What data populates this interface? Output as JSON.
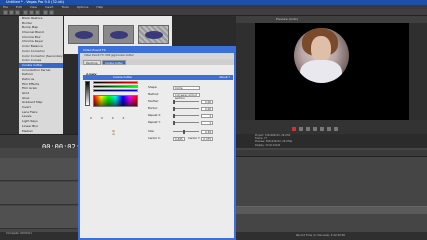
{
  "app": {
    "title": "Untitled * - Vegas Pro 9.0 (32-bit)"
  },
  "menu": [
    "File",
    "Edit",
    "View",
    "Insert",
    "Tools",
    "Options",
    "Help"
  ],
  "left_list": {
    "items": [
      "Black Restore",
      "Border",
      "Bump Map",
      "Channel Blend",
      "Chroma Blur",
      "Chroma Keyer",
      "Color Balance",
      "Color Corrector",
      "Color Corrector (Secondary)",
      "Color Curves",
      "Cookie Cutter",
      "Convolution Kernel",
      "Deform",
      "Defocus",
      "Film Effects",
      "Film Grain",
      "Glint",
      "Glow",
      "Gradient Map",
      "Invert",
      "Lens Flare",
      "Levels",
      "Light Rays",
      "Linear Blur",
      "Median",
      "Mirror",
      "Newsprint"
    ],
    "selected_index": 10,
    "footer_tabs": [
      "Project Media",
      "Explorer",
      "Transitions",
      "Video FX"
    ]
  },
  "timeline": {
    "timecode": "00:00:02;17"
  },
  "dialog": {
    "title": "Video Event FX",
    "subtitle": "Video Event FX: 003.jpg/Cookie Cutter",
    "tabs": [
      "Pan/Crop",
      "Cookie Cutter"
    ],
    "brand": "SONY",
    "plugin_name": "Cookie Cutter",
    "about_label": "About ?",
    "rgb_values": [
      "0",
      "0",
      "0",
      "0"
    ],
    "properties": {
      "shape": {
        "label": "Shape:",
        "value": "Circle"
      },
      "method": {
        "label": "Method:",
        "value": "Cut away all but section"
      },
      "feather": {
        "label": "Feather:",
        "value": "0.00"
      },
      "border": {
        "label": "Border:",
        "value": "0.00"
      },
      "repeat_x": {
        "label": "Repeat X:",
        "value": "1"
      },
      "repeat_y": {
        "label": "Repeat Y:",
        "value": "1"
      },
      "size": {
        "label": "Size:",
        "value": "0.39"
      },
      "center_x": {
        "label": "Center X:",
        "value": "0.495"
      },
      "center_y": {
        "label": "Center Y:",
        "value": "0.375"
      }
    }
  },
  "preview": {
    "toolbar_label": "Preview (Auto)",
    "info_lines": [
      "Project: 720x480x32, 29.970i",
      "Frame: 77",
      "Preview: 360x240x32, 29.970p",
      "Display: 171x114x32"
    ]
  },
  "status": {
    "left": "Complete: 00:00:01",
    "record_time": "Record Time (2 channels): 2:42:20:36"
  },
  "colors": {
    "accent": "#3c6fd8",
    "title_bar": "#1e4fa8",
    "dark_bg": "#2b2b2b"
  }
}
